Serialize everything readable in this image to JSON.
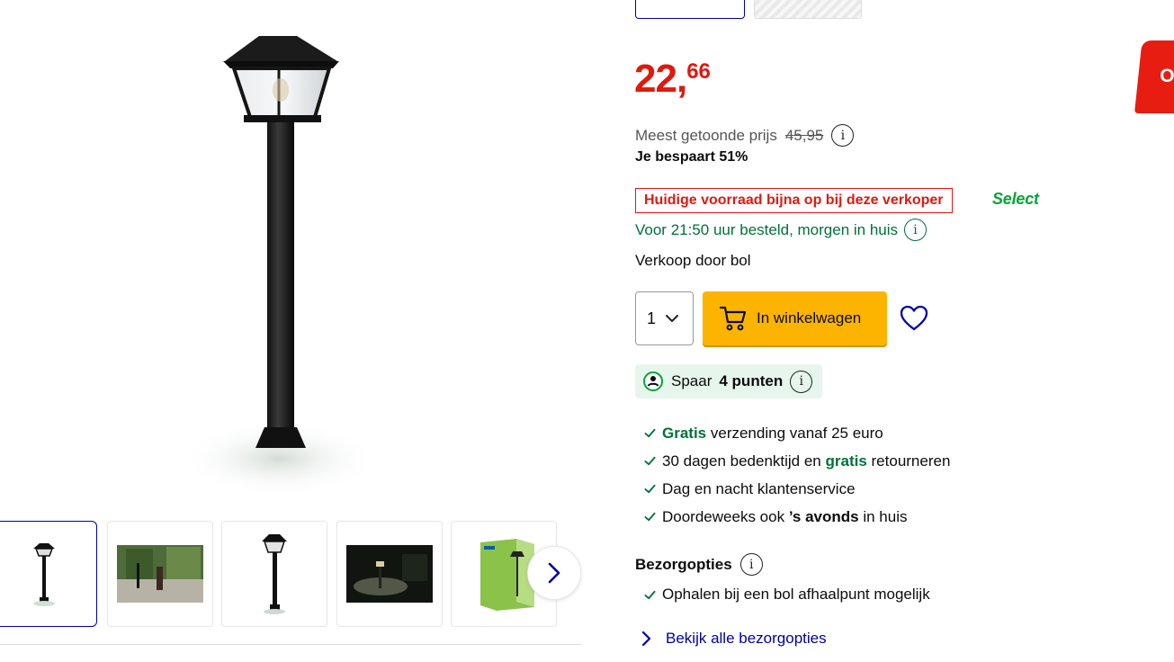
{
  "gallery": {
    "main_image_alt": "Philips tuinlamp sokkel zwart",
    "thumbnails": [
      {
        "icon": "lamp-post-thumb",
        "active": true
      },
      {
        "icon": "garden-scene-thumb",
        "active": false
      },
      {
        "icon": "lamp-post-closeup-thumb",
        "active": false
      },
      {
        "icon": "night-scene-thumb",
        "active": false
      },
      {
        "icon": "packaging-thumb",
        "active": false
      }
    ],
    "next_icon": "chevron-right-icon"
  },
  "promo_tab": {
    "text": "O"
  },
  "price": {
    "integer": "22",
    "comma": ",",
    "decimals": "66"
  },
  "reference_price": {
    "label": "Meest getoonde prijs",
    "old_price": "45,95",
    "info_icon": "info-icon"
  },
  "saving": "Je bespaart 51%",
  "stock_warning": "Huidige voorraad bijna op bij deze verkoper",
  "select_badge": "Select",
  "delivery": {
    "text": "Voor 21:50 uur besteld, morgen in huis",
    "info_icon": "info-icon"
  },
  "seller": "Verkoop door bol",
  "quantity": {
    "value": "1",
    "icon": "chevron-down-icon"
  },
  "cart_button": {
    "label": "In winkelwagen",
    "icon": "cart-icon"
  },
  "wishlist_icon": "heart-icon",
  "points": {
    "prefix": "Spaar",
    "amount": "4 punten",
    "icon": "points-icon"
  },
  "usps": [
    {
      "bold": "Gratis",
      "rest": " verzending vanaf 25 euro"
    },
    {
      "pre": "30 dagen bedenktijd en ",
      "bold": "gratis",
      "rest": " retourneren"
    },
    {
      "text": "Dag en nacht klantenservice"
    },
    {
      "pre": "Doordeweeks ook ",
      "bold": "’s avonds",
      "rest": " in huis"
    }
  ],
  "delivery_options": {
    "title": "Bezorgopties",
    "item": "Ophalen bij een bol afhaalpunt mogelijk",
    "link": "Bekijk alle bezorgopties"
  },
  "colors": {
    "accent_blue": "#0000a4",
    "price_red": "#e0190f",
    "green": "#00703c",
    "cart_yellow": "#fcb400"
  }
}
